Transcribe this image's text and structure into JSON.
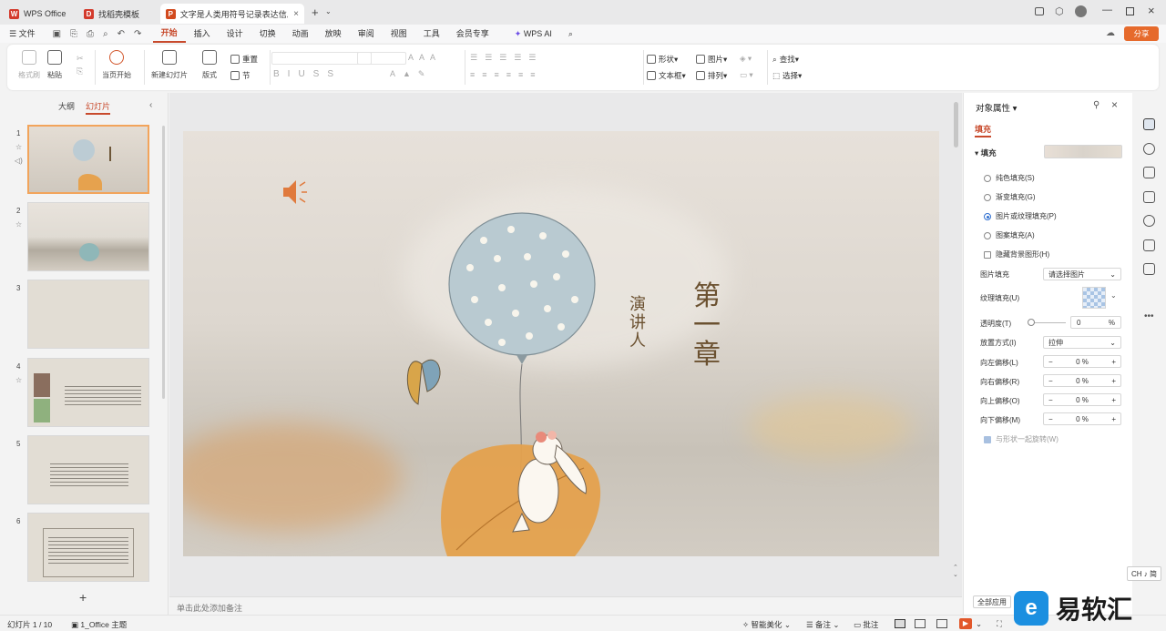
{
  "tabs": [
    {
      "label": "WPS Office",
      "color": "#d33a2c",
      "logo": "W"
    },
    {
      "label": "找稻壳模板",
      "color": "#d33a2c",
      "logo": "D"
    },
    {
      "label": "文字是人类用符号记录表达信息以",
      "color": "#d24a1e",
      "logo": "P"
    }
  ],
  "new_tab": "+",
  "menu": {
    "file": "文件",
    "items": [
      "开始",
      "插入",
      "设计",
      "切换",
      "动画",
      "放映",
      "审阅",
      "视图",
      "工具",
      "会员专享"
    ],
    "wps_ai": "WPS AI",
    "share": "分享"
  },
  "ribbon": {
    "format_painter": "格式刷",
    "paste": "粘贴",
    "play_from_current": "当页开始",
    "new_slide": "新建幻灯片",
    "layout": "版式",
    "reset": "重置",
    "section": "节",
    "shape": "形状",
    "picture": "图片",
    "textbox": "文本框",
    "arrange": "排列",
    "find": "查找",
    "select": "选择"
  },
  "left_panel": {
    "tab_outline": "大纲",
    "tab_slides": "幻灯片",
    "slide_numbers": [
      "1",
      "2",
      "3",
      "4",
      "5",
      "6"
    ],
    "add": "+"
  },
  "slide": {
    "title_chars": [
      "第",
      "一",
      "章"
    ],
    "subtitle_chars": [
      "演",
      "讲",
      "人"
    ]
  },
  "notes_placeholder": "单击此处添加备注",
  "right_panel": {
    "title": "对象属性",
    "tab_fill": "填充",
    "section_fill": "填充",
    "options": [
      {
        "label": "纯色填充(S)",
        "selected": false
      },
      {
        "label": "渐变填充(G)",
        "selected": false
      },
      {
        "label": "图片或纹理填充(P)",
        "selected": true
      },
      {
        "label": "图案填充(A)",
        "selected": false
      }
    ],
    "hide_bg": "隐藏背景图形(H)",
    "picture_fill_label": "图片填充",
    "picture_fill_value": "请选择图片",
    "texture_fill_label": "纹理填充(U)",
    "transparency_label": "透明度(T)",
    "transparency_value": "0",
    "percent": "%",
    "placement_label": "放置方式(I)",
    "placement_value": "拉伸",
    "offsets": [
      {
        "label": "向左偏移(L)",
        "value": "0"
      },
      {
        "label": "向右偏移(R)",
        "value": "0"
      },
      {
        "label": "向上偏移(O)",
        "value": "0"
      },
      {
        "label": "向下偏移(M)",
        "value": "0"
      }
    ],
    "rotate_with_shape": "与形状一起旋转(W)",
    "apply_all": "全部应用"
  },
  "ime": "CH ♪ 简",
  "status": {
    "slide_count": "幻灯片 1 / 10",
    "theme": "1_Office 主题",
    "smart": "智能美化",
    "notes": "备注",
    "comments": "批注"
  },
  "watermark": "易软汇"
}
